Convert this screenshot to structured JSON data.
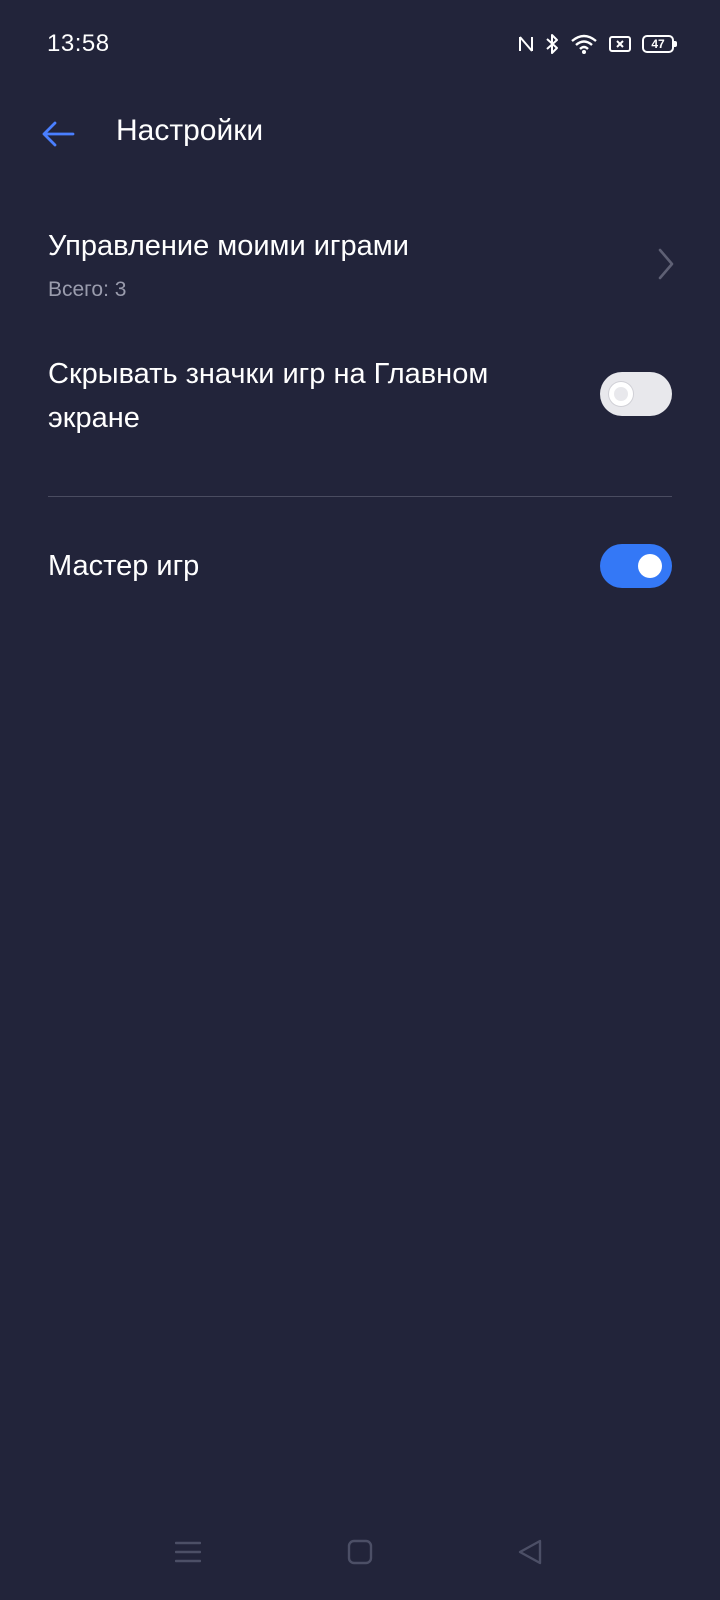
{
  "status_bar": {
    "time": "13:58",
    "battery_level": "47",
    "icons": [
      "nfc-icon",
      "bluetooth-icon",
      "wifi-icon",
      "no-sim-icon",
      "battery-icon"
    ]
  },
  "header": {
    "title": "Настройки",
    "back_icon": "arrow-left-icon"
  },
  "settings": {
    "manage_games": {
      "title": "Управление моими играми",
      "subtitle": "Всего: 3"
    },
    "hide_icons": {
      "title_line1": "Скрывать значки игр на Главном",
      "title_line2": "экране",
      "enabled": false
    },
    "game_master": {
      "title": "Мастер игр",
      "enabled": true
    }
  },
  "nav_bar": {
    "icons": [
      "menu-icon",
      "home-icon",
      "back-triangle-icon"
    ]
  },
  "colors": {
    "background": "#22243a",
    "accent": "#3478f6",
    "back_arrow": "#4a7fff",
    "subtitle": "#9a9cad"
  }
}
